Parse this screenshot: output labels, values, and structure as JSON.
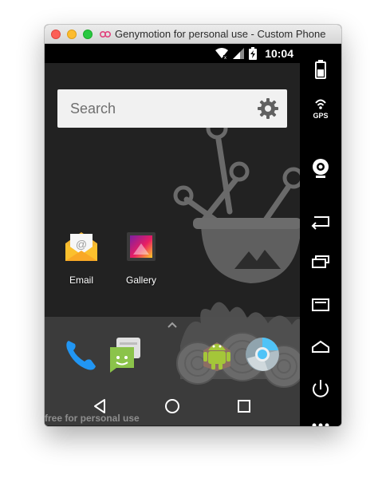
{
  "window": {
    "title": "Genymotion for personal use - Custom Phone"
  },
  "statusbar": {
    "time": "10:04"
  },
  "search": {
    "placeholder": "Search"
  },
  "apps": [
    {
      "label": "Email",
      "icon": "email-icon"
    },
    {
      "label": "Gallery",
      "icon": "gallery-icon"
    }
  ],
  "dock": [
    {
      "icon": "phone-icon"
    },
    {
      "icon": "messaging-icon"
    },
    {
      "icon": "android-icon"
    },
    {
      "icon": "chromium-icon"
    }
  ],
  "navbar": [
    "back-icon",
    "home-icon",
    "recents-icon"
  ],
  "watermark": "free for personal use",
  "sidebar": {
    "gps_label": "GPS",
    "buttons": [
      "battery",
      "gps",
      "webcam",
      "back",
      "recent-apps",
      "menu",
      "home",
      "power",
      "more"
    ]
  },
  "colors": {
    "screen_bg": "#222222",
    "search_bg": "#f1f1f1",
    "phone_blue": "#2196f3",
    "android_green": "#8bc34a"
  }
}
